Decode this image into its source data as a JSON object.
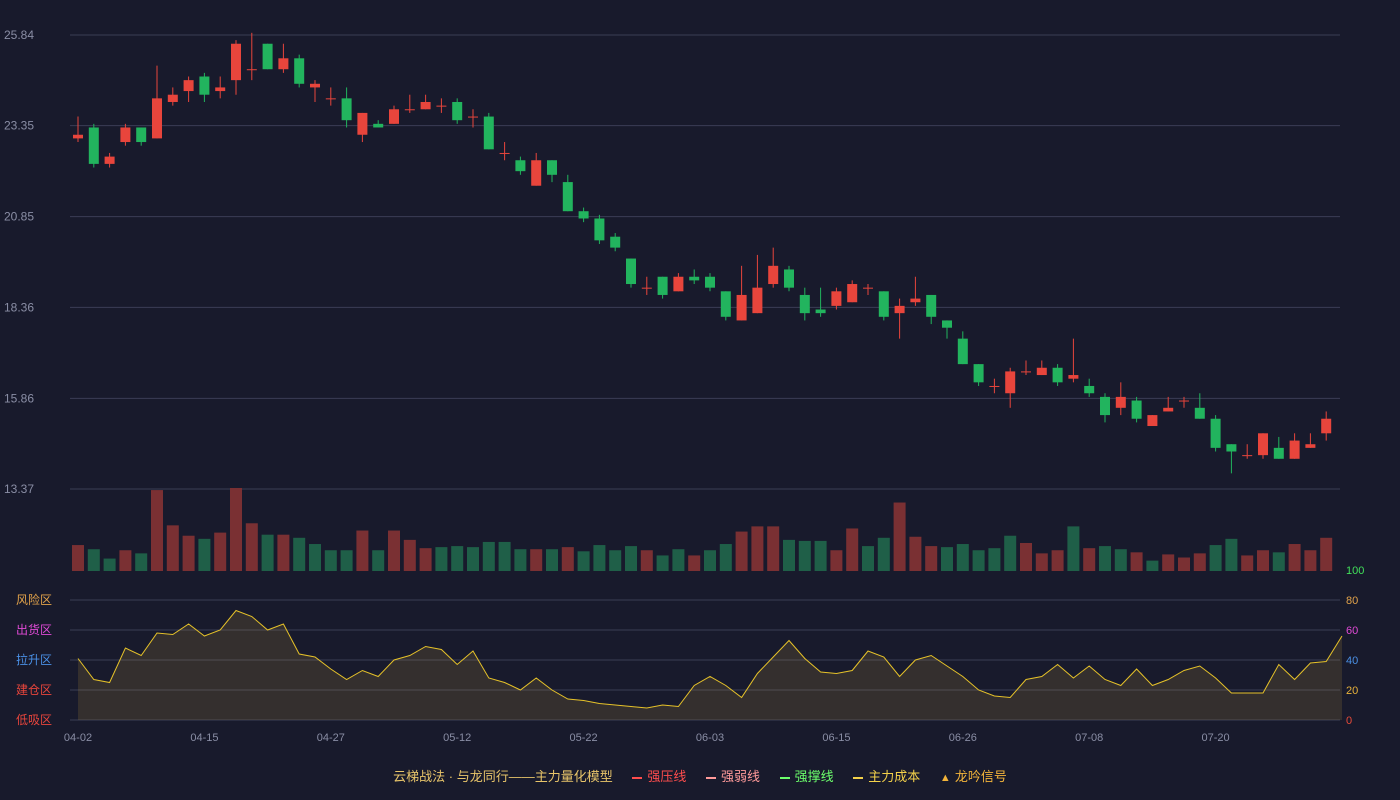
{
  "colors": {
    "background": "#181a2c",
    "grid": "#3a3d55",
    "axis_text": "#8a8ea5",
    "up": "#e8453c",
    "down": "#22b45e",
    "vol_up": "#7a3033",
    "vol_down": "#1f5f48",
    "osc_line": "#e6c229",
    "osc_fill": "rgba(196,160,60,0.16)"
  },
  "legend": {
    "title": "云梯战法 · 与龙同行——主力量化模型",
    "items": [
      {
        "label": "强压线",
        "color": "#ff4d4d",
        "style": "solid"
      },
      {
        "label": "强弱线",
        "color": "#ff9a9a",
        "style": "dash"
      },
      {
        "label": "强撑线",
        "color": "#6cff6c",
        "style": "solid"
      },
      {
        "label": "主力成本",
        "color": "#f3d14a",
        "style": "dash"
      },
      {
        "label": "龙吟信号",
        "color": "#f3b43a",
        "style": "tri"
      }
    ]
  },
  "chart_data": [
    {
      "type": "candlestick",
      "ylim": [
        13.37,
        25.84
      ],
      "y_ticks": [
        "25.84",
        "23.35",
        "20.85",
        "18.36",
        "15.86",
        "13.37"
      ],
      "x_ticks": [
        "04-02",
        "04-15",
        "04-27",
        "05-12",
        "05-22",
        "06-03",
        "06-15",
        "06-26",
        "07-08",
        "07-20"
      ],
      "x_tick_index": [
        0,
        8,
        16,
        24,
        32,
        40,
        48,
        56,
        64,
        72
      ],
      "candles": [
        [
          23.0,
          23.1,
          23.6,
          22.9
        ],
        [
          23.3,
          22.3,
          23.4,
          22.2
        ],
        [
          22.3,
          22.5,
          22.6,
          22.2
        ],
        [
          22.9,
          23.3,
          23.4,
          22.8
        ],
        [
          23.3,
          22.9,
          23.3,
          22.8
        ],
        [
          23.0,
          24.1,
          25.0,
          23.0
        ],
        [
          24.0,
          24.2,
          24.4,
          23.9
        ],
        [
          24.3,
          24.6,
          24.7,
          24.0
        ],
        [
          24.7,
          24.2,
          24.8,
          24.0
        ],
        [
          24.3,
          24.4,
          24.7,
          24.1
        ],
        [
          24.6,
          25.6,
          25.7,
          24.2
        ],
        [
          24.9,
          24.9,
          25.9,
          24.6
        ],
        [
          25.6,
          24.9,
          25.6,
          24.9
        ],
        [
          24.9,
          25.2,
          25.6,
          24.8
        ],
        [
          25.2,
          24.5,
          25.3,
          24.4
        ],
        [
          24.4,
          24.5,
          24.6,
          24.0
        ],
        [
          24.1,
          24.1,
          24.4,
          23.9
        ],
        [
          24.1,
          23.5,
          24.4,
          23.3
        ],
        [
          23.1,
          23.7,
          23.7,
          22.9
        ],
        [
          23.4,
          23.3,
          23.5,
          23.3
        ],
        [
          23.4,
          23.8,
          23.9,
          23.4
        ],
        [
          23.8,
          23.8,
          24.2,
          23.7
        ],
        [
          23.8,
          24.0,
          24.2,
          23.8
        ],
        [
          23.9,
          23.9,
          24.1,
          23.7
        ],
        [
          24.0,
          23.5,
          24.1,
          23.4
        ],
        [
          23.6,
          23.6,
          23.8,
          23.3
        ],
        [
          23.6,
          22.7,
          23.7,
          22.7
        ],
        [
          22.6,
          22.6,
          22.9,
          22.4
        ],
        [
          22.4,
          22.1,
          22.5,
          22.0
        ],
        [
          21.7,
          22.4,
          22.6,
          21.7
        ],
        [
          22.4,
          22.0,
          22.4,
          21.8
        ],
        [
          21.8,
          21.0,
          22.0,
          21.0
        ],
        [
          21.0,
          20.8,
          21.1,
          20.7
        ],
        [
          20.8,
          20.2,
          20.9,
          20.1
        ],
        [
          20.3,
          20.0,
          20.4,
          19.9
        ],
        [
          19.7,
          19.0,
          19.7,
          18.9
        ],
        [
          18.9,
          18.9,
          19.2,
          18.7
        ],
        [
          19.2,
          18.7,
          19.2,
          18.6
        ],
        [
          18.8,
          19.2,
          19.3,
          18.8
        ],
        [
          19.2,
          19.1,
          19.4,
          19.0
        ],
        [
          19.2,
          18.9,
          19.3,
          18.8
        ],
        [
          18.8,
          18.1,
          18.8,
          18.0
        ],
        [
          18.0,
          18.7,
          19.5,
          18.0
        ],
        [
          18.2,
          18.9,
          19.8,
          18.2
        ],
        [
          19.0,
          19.5,
          20.0,
          18.9
        ],
        [
          19.4,
          18.9,
          19.5,
          18.8
        ],
        [
          18.7,
          18.2,
          18.9,
          18.0
        ],
        [
          18.3,
          18.2,
          18.9,
          18.1
        ],
        [
          18.4,
          18.8,
          18.9,
          18.3
        ],
        [
          18.5,
          19.0,
          19.1,
          18.5
        ],
        [
          18.9,
          18.9,
          19.0,
          18.7
        ],
        [
          18.8,
          18.1,
          18.8,
          18.0
        ],
        [
          18.2,
          18.4,
          18.6,
          17.5
        ],
        [
          18.5,
          18.6,
          19.2,
          18.4
        ],
        [
          18.7,
          18.1,
          18.7,
          17.9
        ],
        [
          18.0,
          17.8,
          18.0,
          17.5
        ],
        [
          17.5,
          16.8,
          17.7,
          16.8
        ],
        [
          16.8,
          16.3,
          16.8,
          16.2
        ],
        [
          16.2,
          16.2,
          16.4,
          16.0
        ],
        [
          16.0,
          16.6,
          16.7,
          15.6
        ],
        [
          16.6,
          16.6,
          16.9,
          16.5
        ],
        [
          16.5,
          16.7,
          16.9,
          16.5
        ],
        [
          16.7,
          16.3,
          16.8,
          16.2
        ],
        [
          16.4,
          16.5,
          17.5,
          16.3
        ],
        [
          16.2,
          16.0,
          16.4,
          15.9
        ],
        [
          15.9,
          15.4,
          16.0,
          15.2
        ],
        [
          15.6,
          15.9,
          16.3,
          15.4
        ],
        [
          15.8,
          15.3,
          15.9,
          15.2
        ],
        [
          15.1,
          15.4,
          15.4,
          15.1
        ],
        [
          15.5,
          15.6,
          15.9,
          15.5
        ],
        [
          15.8,
          15.8,
          15.9,
          15.6
        ],
        [
          15.6,
          15.3,
          16.0,
          15.3
        ],
        [
          15.3,
          14.5,
          15.4,
          14.4
        ],
        [
          14.6,
          14.4,
          14.6,
          13.8
        ],
        [
          14.3,
          14.3,
          14.6,
          14.2
        ],
        [
          14.3,
          14.9,
          14.9,
          14.2
        ],
        [
          14.5,
          14.2,
          14.8,
          14.2
        ],
        [
          14.2,
          14.7,
          14.9,
          14.2
        ],
        [
          14.5,
          14.6,
          14.9,
          14.5
        ],
        [
          14.9,
          15.3,
          15.5,
          14.7
        ]
      ]
    },
    {
      "type": "bar",
      "title": "volume",
      "values": [
        25,
        21,
        12,
        20,
        17,
        78,
        44,
        34,
        31,
        37,
        80,
        46,
        35,
        35,
        32,
        26,
        20,
        20,
        39,
        20,
        39,
        30,
        22,
        23,
        24,
        23,
        28,
        28,
        21,
        21,
        21,
        23,
        19,
        25,
        20,
        24,
        20,
        15,
        21,
        15,
        20,
        26,
        38,
        43,
        43,
        30,
        29,
        29,
        20,
        41,
        24,
        32,
        66,
        33,
        24,
        23,
        26,
        20,
        22,
        34,
        27,
        17,
        20,
        43,
        22,
        24,
        21,
        18,
        10,
        16,
        13,
        17,
        25,
        31,
        15,
        20,
        18,
        26,
        20,
        32
      ],
      "up": [
        1,
        0,
        0,
        1,
        0,
        1,
        1,
        1,
        0,
        1,
        1,
        1,
        0,
        1,
        0,
        0,
        0,
        0,
        1,
        0,
        1,
        1,
        1,
        0,
        0,
        0,
        0,
        0,
        0,
        1,
        0,
        1,
        0,
        0,
        0,
        0,
        1,
        0,
        0,
        1,
        0,
        0,
        1,
        1,
        1,
        0,
        0,
        0,
        1,
        1,
        0,
        0,
        1,
        1,
        1,
        0,
        0,
        0,
        0,
        0,
        1,
        1,
        1,
        0,
        1,
        0,
        0,
        1,
        0,
        1,
        1,
        1,
        0,
        0,
        1,
        1,
        0,
        1,
        1,
        1
      ]
    },
    {
      "type": "area",
      "title": "oscillator",
      "ylim": [
        0,
        100
      ],
      "y_ticks": [
        "100",
        "80",
        "60",
        "40",
        "20",
        "0"
      ],
      "y_tick_colors": [
        "#41e05a",
        "#e3a34a",
        "#e04ad6",
        "#4a90e6",
        "#e8b23a",
        "#e84b3a"
      ],
      "zones": [
        "风险区",
        "出货区",
        "拉升区",
        "建仓区",
        "低吸区"
      ],
      "zone_colors": [
        "#e3a34a",
        "#e04ad6",
        "#4a90e6",
        "#e8453c",
        "#e8453c"
      ],
      "values": [
        41,
        27,
        25,
        48,
        43,
        58,
        57,
        64,
        56,
        60,
        73,
        69,
        60,
        64,
        44,
        42,
        34,
        27,
        33,
        29,
        40,
        43,
        49,
        47,
        37,
        46,
        28,
        25,
        20,
        28,
        20,
        14,
        13,
        11,
        10,
        9,
        8,
        10,
        9,
        23,
        29,
        23,
        15,
        31,
        42,
        53,
        41,
        32,
        31,
        33,
        46,
        42,
        29,
        40,
        43,
        36,
        29,
        20,
        16,
        15,
        27,
        29,
        37,
        28,
        36,
        27,
        23,
        34,
        23,
        27,
        33,
        36,
        28,
        18,
        18,
        18,
        37,
        27,
        38,
        39,
        56
      ]
    }
  ]
}
